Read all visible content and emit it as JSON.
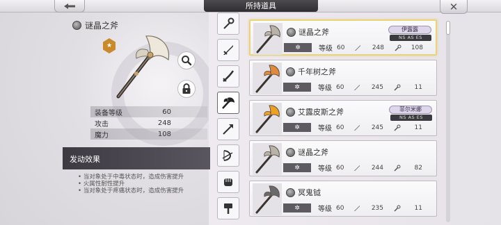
{
  "header": {
    "title": "所持道具",
    "back_label": "←",
    "close_label": "✕"
  },
  "detail": {
    "name": "谜晶之斧",
    "rank_label": "★",
    "stats": [
      {
        "label": "装备等级",
        "value": "60"
      },
      {
        "label": "攻击",
        "value": "248"
      },
      {
        "label": "魔力",
        "value": "108"
      }
    ],
    "effect_header": "发动效果",
    "effects": [
      "当对象处于中毒状态时，造成伤害提升",
      "火属性耐性提升",
      "当对象处于疼痛状态时，造成伤害提升"
    ]
  },
  "categories": [
    {
      "icon": "staff-icon"
    },
    {
      "icon": "sword-icon"
    },
    {
      "icon": "katana-icon"
    },
    {
      "icon": "axe-icon",
      "active": true
    },
    {
      "icon": "spear-icon"
    },
    {
      "icon": "bow-icon"
    },
    {
      "icon": "fist-icon"
    },
    {
      "icon": "hammer-icon"
    }
  ],
  "items": [
    {
      "name": "谜晶之斧",
      "owner": "伊露露",
      "tags": "NS AS ES",
      "star": "✲",
      "level_label": "等级",
      "level": "60",
      "atk": "248",
      "mag": "108",
      "selected": true,
      "axe_color": "#b9b2a8"
    },
    {
      "name": "千年树之斧",
      "owner": "",
      "tags": "",
      "star": "✲",
      "level_label": "等级",
      "level": "60",
      "atk": "245",
      "mag": "11",
      "selected": false,
      "axe_color": "#e08a3a"
    },
    {
      "name": "艾露皮斯之斧",
      "owner": "菲尔米娜",
      "tags": "NS AS ES",
      "star": "✲",
      "level_label": "等级",
      "level": "60",
      "atk": "245",
      "mag": "11",
      "selected": false,
      "axe_color": "#f0a020"
    },
    {
      "name": "谜晶之斧",
      "owner": "",
      "tags": "",
      "star": "✲",
      "level_label": "等级",
      "level": "60",
      "atk": "244",
      "mag": "82",
      "selected": false,
      "axe_color": "#b9b2a8"
    },
    {
      "name": "冥鬼钺",
      "owner": "",
      "tags": "",
      "star": "✲",
      "level_label": "等级",
      "level": "60",
      "atk": "235",
      "mag": "11",
      "selected": false,
      "axe_color": "#6a6a6a"
    }
  ]
}
